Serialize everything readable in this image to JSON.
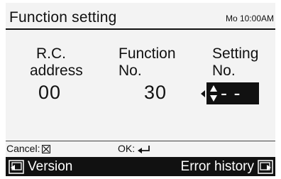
{
  "header": {
    "title": "Function setting",
    "clock": "Mo 10:00AM"
  },
  "columns": {
    "rc_address": {
      "label_line1": "R.C.",
      "label_line2": "address",
      "value": "00"
    },
    "function_no": {
      "label_line1": "Function",
      "label_line2": "No.",
      "value": "30"
    },
    "setting_no": {
      "label_line1": "Setting",
      "label_line2": "No.",
      "value": "- -"
    }
  },
  "footer": {
    "cancel_label": "Cancel:",
    "ok_label": "OK:"
  },
  "bottom_bar": {
    "left_button": "Version",
    "right_button": "Error history"
  },
  "icons": {
    "left_arrow": "left-arrow-icon",
    "up_down": "up-down-arrows-icon",
    "cancel": "cancel-box-icon",
    "enter": "enter-return-icon",
    "version": "version-button-icon",
    "error_history": "error-history-button-icon"
  }
}
